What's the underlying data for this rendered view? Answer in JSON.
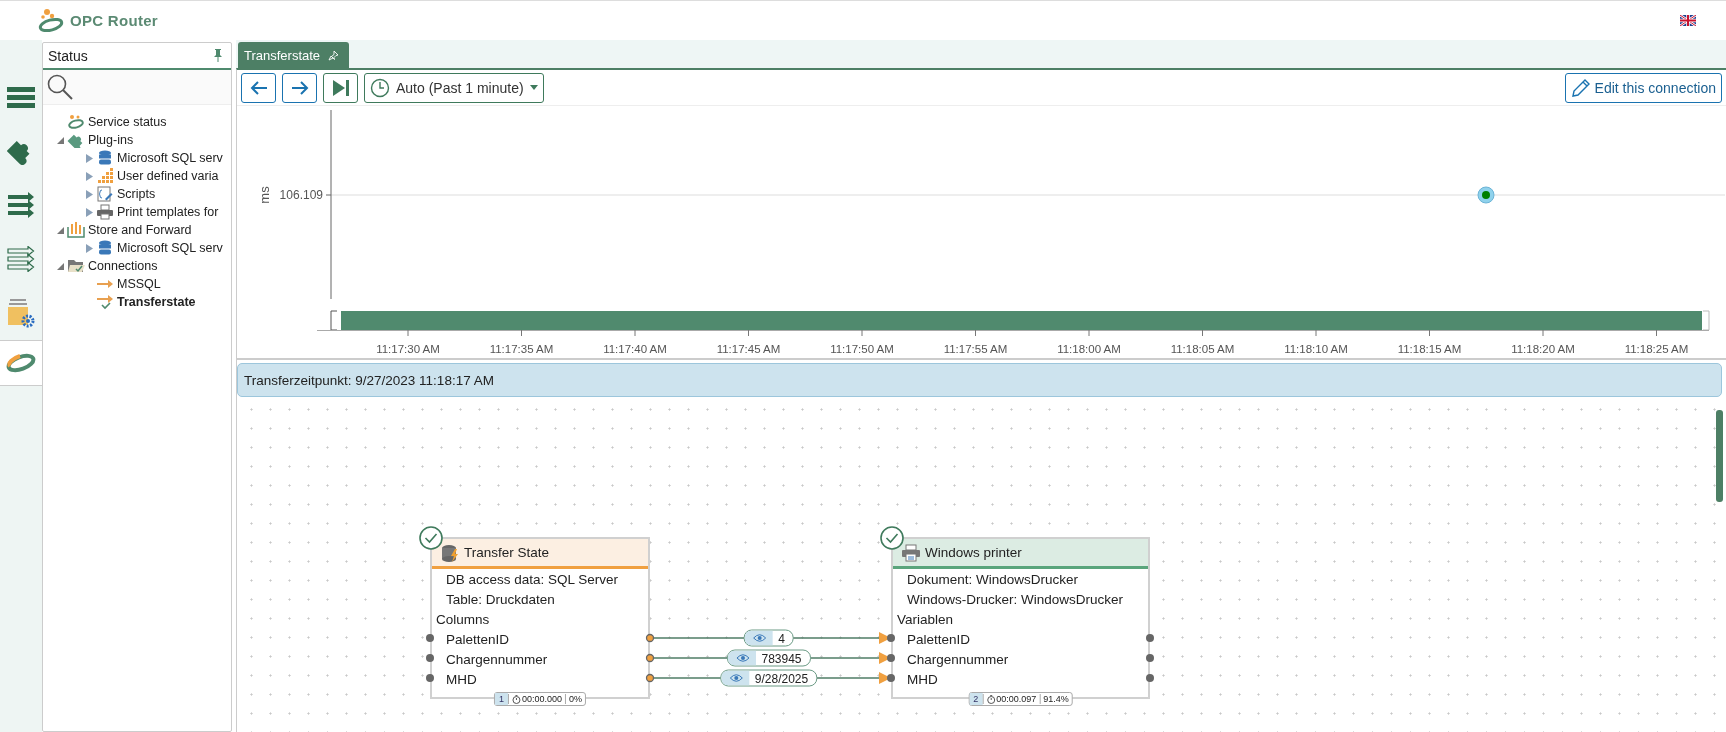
{
  "app": {
    "title": "OPC Router"
  },
  "rail": [
    {
      "kind": "menu",
      "selected": false
    },
    {
      "kind": "plugins",
      "selected": false
    },
    {
      "kind": "transfer-filled",
      "selected": false
    },
    {
      "kind": "transfer-outline",
      "selected": false
    },
    {
      "kind": "settings-folder",
      "selected": false
    },
    {
      "kind": "status",
      "selected": true
    }
  ],
  "status_panel": {
    "title": "Status",
    "tree": [
      {
        "label": "Service status",
        "kind": "service",
        "selected": false
      },
      {
        "label": "Plug-ins",
        "kind": "plugins",
        "expanded": true,
        "selected": false,
        "children": [
          {
            "label": "Microsoft SQL serv",
            "kind": "database",
            "expanded": false,
            "selected": false
          },
          {
            "label": "User defined varia",
            "kind": "variables",
            "expanded": false,
            "selected": false
          },
          {
            "label": "Scripts",
            "kind": "scripts",
            "expanded": false,
            "selected": false
          },
          {
            "label": "Print templates for",
            "kind": "printer",
            "expanded": false,
            "selected": false
          }
        ]
      },
      {
        "label": "Store and Forward",
        "kind": "store",
        "expanded": true,
        "selected": false,
        "children": [
          {
            "label": "Microsoft SQL serv",
            "kind": "database",
            "expanded": false,
            "selected": false
          }
        ]
      },
      {
        "label": "Connections",
        "kind": "connections",
        "expanded": true,
        "selected": false,
        "children": [
          {
            "label": "MSSQL",
            "kind": "connection",
            "selected": false
          },
          {
            "label": "Transferstate",
            "kind": "connection-checked",
            "selected": true
          }
        ]
      }
    ]
  },
  "tabs": [
    {
      "label": "Transferstate",
      "selected": true
    }
  ],
  "toolbar": {
    "time_range": "Auto (Past 1 minute)",
    "edit_button": "Edit this connection"
  },
  "chart": {
    "y_axis_label": "ms",
    "y_tick": "106.109",
    "x_tick_labels": [
      "11:17:30 AM",
      "11:17:35 AM",
      "11:17:40 AM",
      "11:17:45 AM",
      "11:17:50 AM",
      "11:17:55 AM",
      "11:18:00 AM",
      "11:18:05 AM",
      "11:18:10 AM",
      "11:18:15 AM",
      "11:18:20 AM",
      "11:18:25 AM"
    ]
  },
  "info_bar": "Transferzeitpunkt: 9/27/2023 11:18:17 AM",
  "nodes": [
    {
      "title": "Transfer State",
      "kind": "source",
      "ok": true,
      "details": [
        "DB access data: SQL Server",
        "Table: Druckdaten"
      ],
      "section": "Columns",
      "fields": [
        "PalettenID",
        "Chargennummer",
        "MHD"
      ],
      "stats": {
        "step": "1",
        "duration": "00:00.000",
        "percent": "0%"
      }
    },
    {
      "title": "Windows printer",
      "kind": "target",
      "ok": true,
      "details": [
        "Dokument: WindowsDrucker",
        "Windows-Drucker: WindowsDrucker"
      ],
      "section": "Variablen",
      "fields": [
        "PalettenID",
        "Chargennummer",
        "MHD"
      ],
      "stats": {
        "step": "2",
        "duration": "00:00.097",
        "percent": "91.4%"
      }
    }
  ],
  "connections": [
    {
      "value": "4"
    },
    {
      "value": "783945"
    },
    {
      "value": "9/28/2025"
    }
  ]
}
